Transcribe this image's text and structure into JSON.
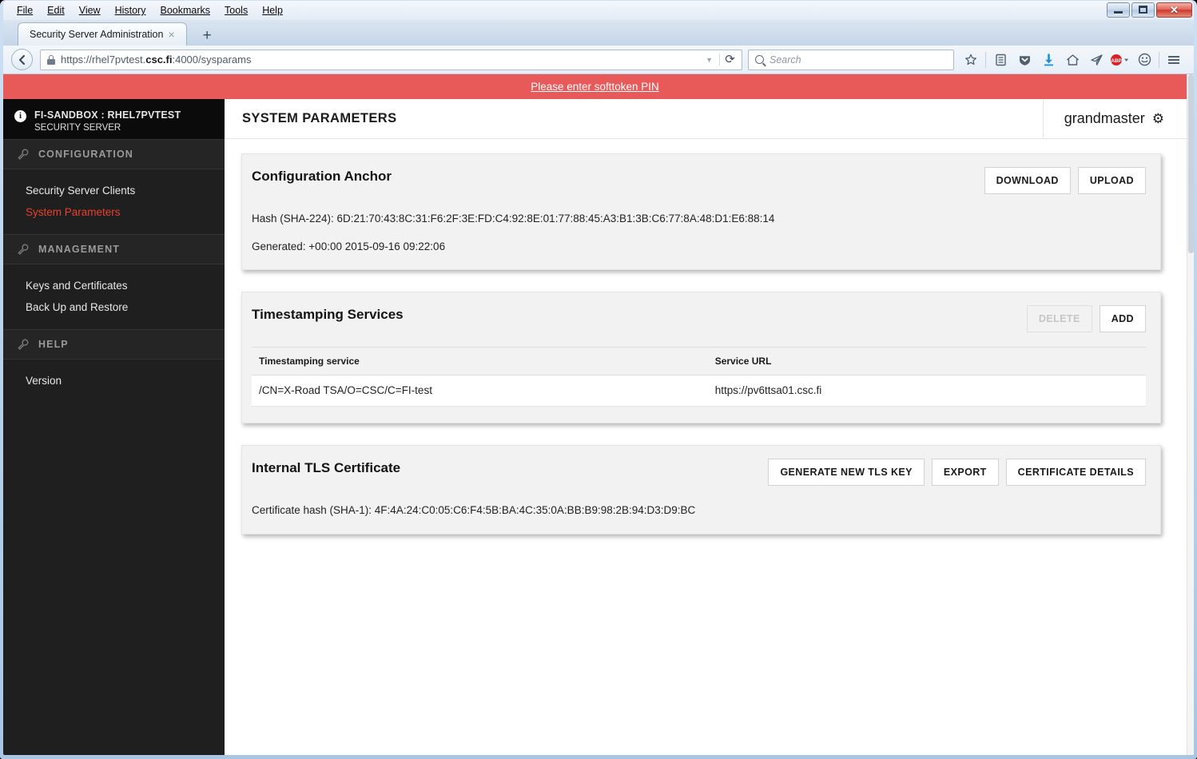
{
  "browser": {
    "menus": [
      "File",
      "Edit",
      "View",
      "History",
      "Bookmarks",
      "Tools",
      "Help"
    ],
    "tab_title": "Security Server Administration",
    "tab_close_glyph": "×",
    "newtab_glyph": "+",
    "url_prefix": "https://rhel7pvtest.",
    "url_domain": "csc.fi",
    "url_suffix": ":4000/sysparams",
    "search_placeholder": "Search",
    "back_glyph": "←",
    "reload_glyph": "⟳",
    "dropdown_glyph": "▼",
    "window_controls": {
      "minimize": "minimize",
      "maximize": "restore",
      "close": "✕"
    },
    "toolbar_icons": [
      "bookmark-star-icon",
      "reader-list-icon",
      "pocket-shield-icon",
      "downloads-icon",
      "home-icon",
      "share-paperplane-icon",
      "adblock-plus-icon",
      "feedback-smiley-icon",
      "hamburger-menu-icon"
    ],
    "adblock_label": "ABP"
  },
  "notification": {
    "message": "Please enter softtoken PIN"
  },
  "sidebar": {
    "org": "FI-SANDBOX : RHEL7PVTEST",
    "subtitle": "SECURITY SERVER",
    "info_glyph": "i",
    "sections": [
      {
        "label": "CONFIGURATION",
        "items": [
          {
            "label": "Security Server Clients",
            "active": false
          },
          {
            "label": "System Parameters",
            "active": true
          }
        ]
      },
      {
        "label": "MANAGEMENT",
        "items": [
          {
            "label": "Keys and Certificates",
            "active": false
          },
          {
            "label": "Back Up and Restore",
            "active": false
          }
        ]
      },
      {
        "label": "HELP",
        "items": [
          {
            "label": "Version",
            "active": false
          }
        ]
      }
    ]
  },
  "header": {
    "page_title": "SYSTEM PARAMETERS",
    "user": "grandmaster",
    "gear_glyph": "⚙"
  },
  "panels": {
    "anchor": {
      "title": "Configuration Anchor",
      "download_label": "DOWNLOAD",
      "upload_label": "UPLOAD",
      "hash_line": "Hash (SHA-224): 6D:21:70:43:8C:31:F6:2F:3E:FD:C4:92:8E:01:77:88:45:A3:B1:3B:C6:77:8A:48:D1:E6:88:14",
      "generated_line": "Generated: +00:00 2015-09-16 09:22:06"
    },
    "timestamping": {
      "title": "Timestamping Services",
      "delete_label": "DELETE",
      "delete_disabled": true,
      "add_label": "ADD",
      "columns": [
        "Timestamping service",
        "Service URL"
      ],
      "rows": [
        {
          "service": "/CN=X-Road TSA/O=CSC/C=FI-test",
          "url": "https://pv6ttsa01.csc.fi"
        }
      ]
    },
    "tls": {
      "title": "Internal TLS Certificate",
      "generate_label": "GENERATE NEW TLS KEY",
      "export_label": "EXPORT",
      "details_label": "CERTIFICATE DETAILS",
      "hash_line": "Certificate hash (SHA-1): 4F:4A:24:C0:05:C6:F4:5B:BA:4C:35:0A:BB:B9:98:2B:94:D3:D9:BC"
    }
  },
  "colors": {
    "notification_red": "#e8595a",
    "sidebar_dark": "#1f1f1f",
    "sidebar_header": "#0b0b0b",
    "active_link_red": "#e8402d",
    "panel_bg": "#f2f2f2"
  }
}
